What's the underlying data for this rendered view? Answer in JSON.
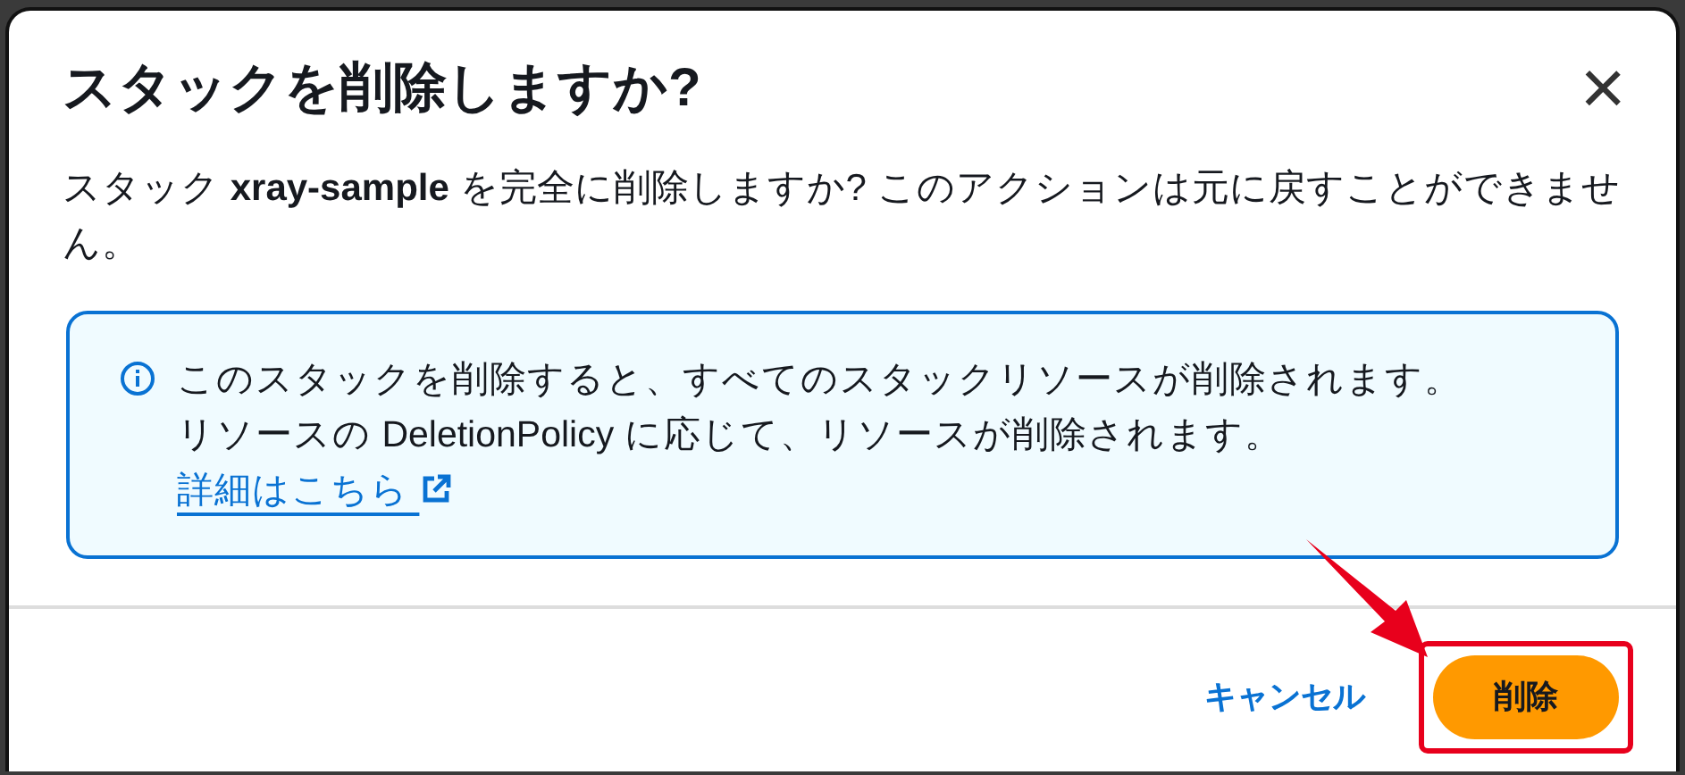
{
  "dialog": {
    "title": "スタックを削除しますか?",
    "close": "×",
    "message": "スタック **xray-sample** を完全に削除しますか? このアクションは元に戻すことができません。",
    "alert": {
      "text": "このスタックを削除すると、すべてのスタックリソースが削除されます。リソースの DeletionPolicy に応じて、リソースが削除されます。",
      "link": "詳細はこちら"
    },
    "buttons": [
      {
        "label": "キャンセル",
        "kind": "link",
        "highlighted": false
      },
      {
        "label": "削除",
        "kind": "primary",
        "highlighted": true
      }
    ]
  }
}
